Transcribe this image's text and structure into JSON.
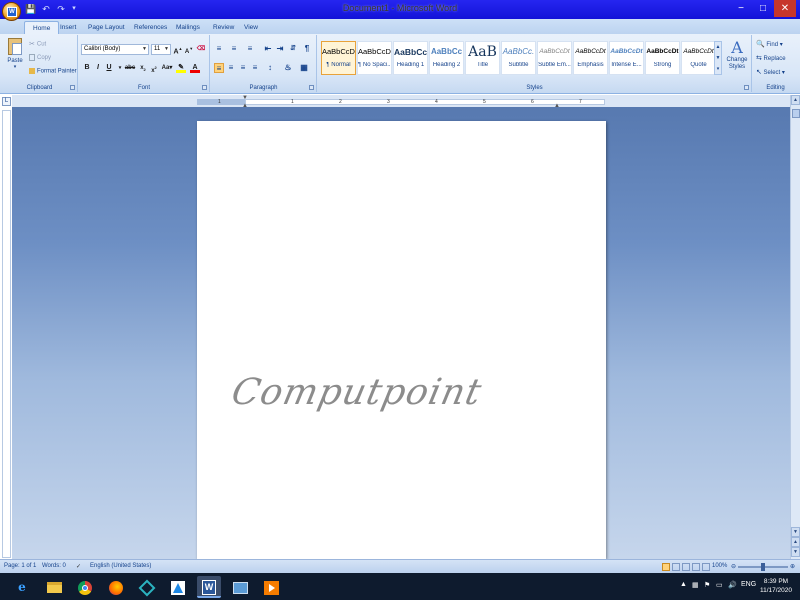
{
  "window": {
    "title": "Document1 - Microsoft Word",
    "controls": [
      "−",
      "□",
      "✕"
    ]
  },
  "quick_access": [
    "save-icon",
    "undo-icon",
    "redo-icon"
  ],
  "tabs": [
    "Home",
    "Insert",
    "Page Layout",
    "References",
    "Mailings",
    "Review",
    "View"
  ],
  "active_tab": "Home",
  "ribbon": {
    "clipboard": {
      "label": "Clipboard",
      "paste": "Paste",
      "cut": "Cut",
      "copy": "Copy",
      "format_painter": "Format Painter"
    },
    "font": {
      "label": "Font",
      "font_name": "Calibri (Body)",
      "font_size": "11"
    },
    "paragraph": {
      "label": "Paragraph"
    },
    "styles": {
      "label": "Styles",
      "change_styles": "Change Styles",
      "items": [
        {
          "preview": "AaBbCcDc",
          "name": "¶ Normal"
        },
        {
          "preview": "AaBbCcDc",
          "name": "¶ No Spaci..."
        },
        {
          "preview": "AaBbCc",
          "name": "Heading 1"
        },
        {
          "preview": "AaBbCc",
          "name": "Heading 2"
        },
        {
          "preview": "AaB",
          "name": "Title"
        },
        {
          "preview": "AaBbCc.",
          "name": "Subtitle"
        },
        {
          "preview": "AaBbCcDt",
          "name": "Subtle Em..."
        },
        {
          "preview": "AaBbCcDt",
          "name": "Emphasis"
        },
        {
          "preview": "AaBbCcDt",
          "name": "Intense E..."
        },
        {
          "preview": "AaBbCcDt",
          "name": "Strong"
        },
        {
          "preview": "AaBbCcDt",
          "name": "Quote"
        }
      ],
      "selected_index": 0
    },
    "editing": {
      "label": "Editing",
      "find": "Find",
      "replace": "Replace",
      "select": "Select"
    }
  },
  "ruler": {
    "numbers": [
      "1",
      "1",
      "2",
      "3",
      "4",
      "5",
      "6",
      "7"
    ]
  },
  "document": {
    "wordart": "Computpoint"
  },
  "status": {
    "page": "Page: 1 of 1",
    "words": "Words: 0",
    "language": "English (United States)",
    "zoom": "100%"
  },
  "taskbar": {
    "apps": [
      "ie-icon",
      "file-explorer-icon",
      "chrome-icon",
      "firefox-icon",
      "app-icon",
      "app-icon-2",
      "word-icon",
      "window-icon",
      "media-icon"
    ],
    "active_app": "word-icon",
    "language": "ENG",
    "time": "8:39 PM",
    "date": "11/17/2020"
  }
}
